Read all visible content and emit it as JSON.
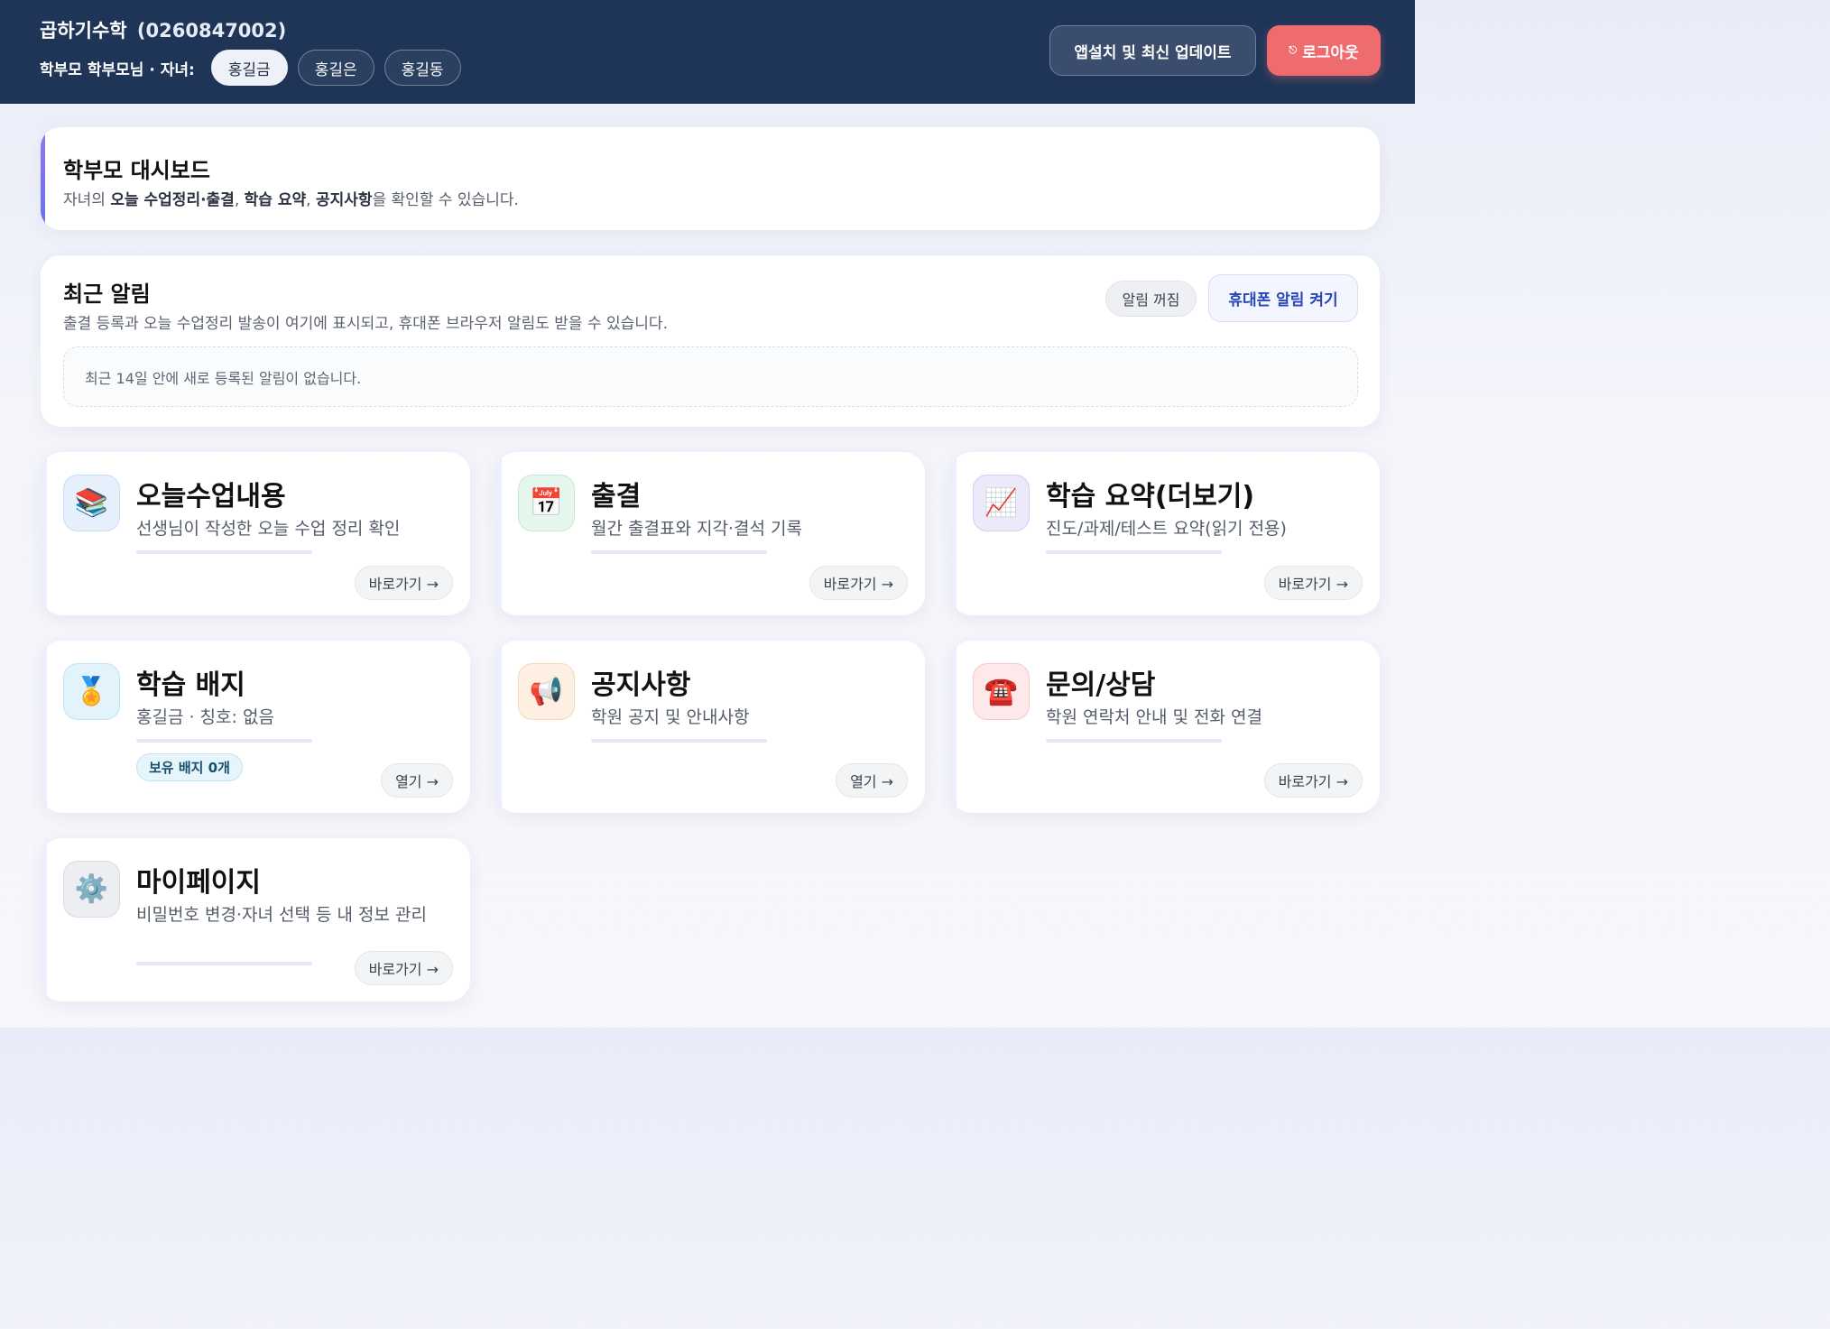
{
  "header": {
    "academy_name": "곱하기수학",
    "academy_code": "(0260847002)",
    "parent_label": "학부모 학부모님 · 자녀:",
    "children": [
      "홍길금",
      "홍길은",
      "홍길동"
    ],
    "active_child_index": 0,
    "install_button": "앱설치 및 최신 업데이트",
    "logout_button": "로그아웃",
    "logout_icon": "⎋"
  },
  "intro": {
    "title": "학부모 대시보드",
    "desc_prefix": "자녀의 ",
    "desc_bold1": "오늘 수업정리·출결",
    "desc_sep1": ", ",
    "desc_bold2": "학습 요약",
    "desc_sep2": ", ",
    "desc_bold3": "공지사항",
    "desc_suffix": "을 확인할 수 있습니다."
  },
  "notifications": {
    "title": "최근 알림",
    "desc": "출결 등록과 오늘 수업정리 발송이 여기에 표시되고, 휴대폰 브라우저 알림도 받을 수 있습니다.",
    "off_button": "알림 꺼짐",
    "on_button": "휴대폰 알림 켜기",
    "empty_message": "최근 14일 안에 새로 등록된 알림이 없습니다."
  },
  "cards": {
    "today_class": {
      "icon": "📚",
      "title": "오늘수업내용",
      "subtitle": "선생님이 작성한 오늘 수업 정리 확인",
      "action": "바로가기 →"
    },
    "attendance": {
      "icon": "📅",
      "title": "출결",
      "subtitle": "월간 출결표와 지각·결석 기록",
      "action": "바로가기 →"
    },
    "study_summary": {
      "icon": "📈",
      "title": "학습 요약(더보기)",
      "subtitle": "진도/과제/테스트 요약(읽기 전용)",
      "action": "바로가기 →"
    },
    "badge": {
      "icon": "🏅",
      "title": "학습 배지",
      "subtitle": "홍길금 · 칭호: 없음",
      "pill": "보유 배지 0개",
      "action": "열기 →"
    },
    "notice": {
      "icon": "📢",
      "title": "공지사항",
      "subtitle": "학원 공지 및 안내사항",
      "action": "열기 →"
    },
    "inquiry": {
      "icon": "☎️",
      "title": "문의/상담",
      "subtitle": "학원 연락처 안내 및 전화 연결",
      "action": "바로가기 →"
    },
    "mypage": {
      "icon": "⚙️",
      "title": "마이페이지",
      "subtitle": "비밀번호 변경·자녀 선택 등 내 정보 관리",
      "action": "바로가기 →"
    }
  },
  "colors": {
    "header_bg": "#1e3558",
    "logout_bg": "#ee6b6e",
    "accent_blue": "#2845b8",
    "accent_purple": "#8b7bf0"
  }
}
